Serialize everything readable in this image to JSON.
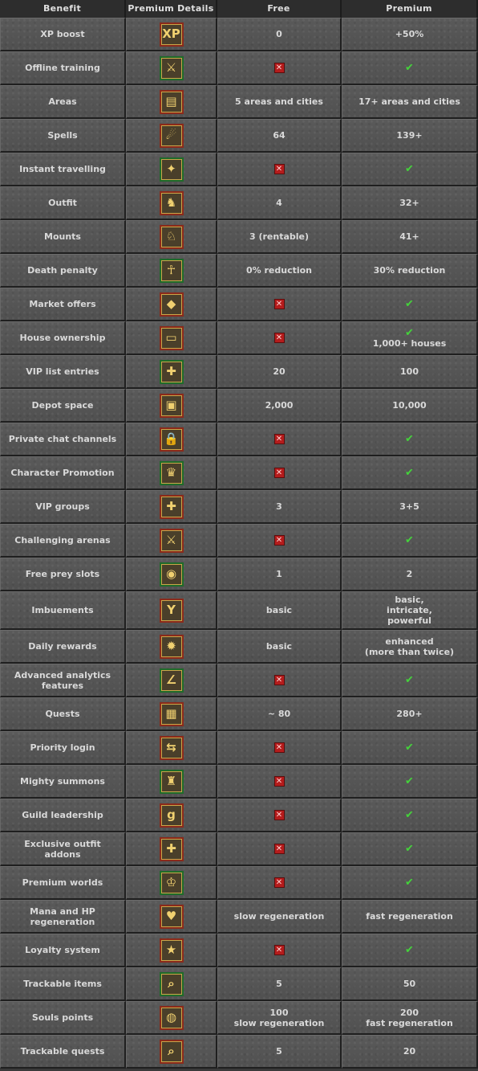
{
  "headers": {
    "benefit": "Benefit",
    "details": "Premium Details",
    "free": "Free",
    "premium": "Premium"
  },
  "colors": {
    "cross": "#b51c1c",
    "check": "#44d23b"
  },
  "rows": [
    {
      "benefit": "XP boost",
      "icon": "xp-boost-icon",
      "glyph": "XP",
      "free": "0",
      "premium": "+50%"
    },
    {
      "benefit": "Offline training",
      "icon": "offline-training-icon",
      "glyph": "⚔",
      "free": "x",
      "premium": "ok"
    },
    {
      "benefit": "Areas",
      "icon": "map-icon",
      "glyph": "▤",
      "free": "5 areas and cities",
      "premium": "17+ areas and cities"
    },
    {
      "benefit": "Spells",
      "icon": "fireball-icon",
      "glyph": "☄",
      "free": "64",
      "premium": "139+"
    },
    {
      "benefit": "Instant travelling",
      "icon": "compass-star-icon",
      "glyph": "✦",
      "free": "x",
      "premium": "ok"
    },
    {
      "benefit": "Outfit",
      "icon": "outfit-icon",
      "glyph": "♞",
      "free": "4",
      "premium": "32+"
    },
    {
      "benefit": "Mounts",
      "icon": "mount-icon",
      "glyph": "♘",
      "free": "3 (rentable)",
      "premium": "41+"
    },
    {
      "benefit": "Death penalty",
      "icon": "ankh-icon",
      "glyph": "☥",
      "free": "0% reduction",
      "premium": "30% reduction"
    },
    {
      "benefit": "Market offers",
      "icon": "market-bag-icon",
      "glyph": "◆",
      "free": "x",
      "premium": "ok"
    },
    {
      "benefit": "House ownership",
      "icon": "house-sign-icon",
      "glyph": "▭",
      "free": "x",
      "premium": "ok",
      "premium_extra": "1,000+ houses"
    },
    {
      "benefit": "VIP list entries",
      "icon": "vip-add-icon",
      "glyph": "✚",
      "free": "20",
      "premium": "100"
    },
    {
      "benefit": "Depot space",
      "icon": "depot-icon",
      "glyph": "▣",
      "free": "2,000",
      "premium": "10,000"
    },
    {
      "benefit": "Private chat channels",
      "icon": "private-chat-icon",
      "glyph": "🔒",
      "free": "x",
      "premium": "ok"
    },
    {
      "benefit": "Character Promotion",
      "icon": "promotion-icon",
      "glyph": "♛",
      "free": "x",
      "premium": "ok"
    },
    {
      "benefit": "VIP groups",
      "icon": "vip-groups-icon",
      "glyph": "✚",
      "free": "3",
      "premium": "3+5"
    },
    {
      "benefit": "Challenging arenas",
      "icon": "crossed-swords-icon",
      "glyph": "⚔",
      "free": "x",
      "premium": "ok"
    },
    {
      "benefit": "Free prey slots",
      "icon": "prey-icon",
      "glyph": "◉",
      "free": "1",
      "premium": "2"
    },
    {
      "benefit": "Imbuements",
      "icon": "imbuement-icon",
      "glyph": "Y",
      "free": "basic",
      "premium": "basic,\nintricate,\npowerful"
    },
    {
      "benefit": "Daily rewards",
      "icon": "daily-reward-icon",
      "glyph": "✹",
      "free": "basic",
      "premium": "enhanced\n(more than twice)"
    },
    {
      "benefit": "Advanced analytics\nfeatures",
      "icon": "analytics-icon",
      "glyph": "∠",
      "free": "x",
      "premium": "ok"
    },
    {
      "benefit": "Quests",
      "icon": "quest-book-icon",
      "glyph": "▦",
      "free": "~ 80",
      "premium": "280+"
    },
    {
      "benefit": "Priority login",
      "icon": "priority-login-icon",
      "glyph": "⇆",
      "free": "x",
      "premium": "ok"
    },
    {
      "benefit": "Mighty summons",
      "icon": "summon-icon",
      "glyph": "♜",
      "free": "x",
      "premium": "ok"
    },
    {
      "benefit": "Guild leadership",
      "icon": "guild-banner-icon",
      "glyph": "g",
      "free": "x",
      "premium": "ok"
    },
    {
      "benefit": "Exclusive outfit\naddons",
      "icon": "outfit-addon-icon",
      "glyph": "✚",
      "free": "x",
      "premium": "ok"
    },
    {
      "benefit": "Premium worlds",
      "icon": "premium-world-icon",
      "glyph": "♔",
      "free": "x",
      "premium": "ok"
    },
    {
      "benefit": "Mana and HP\nregeneration",
      "icon": "regeneration-icon",
      "glyph": "♥",
      "free": "slow regeneration",
      "premium": "fast regeneration"
    },
    {
      "benefit": "Loyalty system",
      "icon": "loyalty-star-icon",
      "glyph": "★",
      "free": "x",
      "premium": "ok"
    },
    {
      "benefit": "Trackable items",
      "icon": "trackable-items-icon",
      "glyph": "⌕",
      "free": "5",
      "premium": "50"
    },
    {
      "benefit": "Souls points",
      "icon": "soul-stone-icon",
      "glyph": "◍",
      "free": "100\nslow regeneration",
      "premium": "200\nfast regeneration"
    },
    {
      "benefit": "Trackable quests",
      "icon": "trackable-quests-icon",
      "glyph": "⌕",
      "free": "5",
      "premium": "20"
    }
  ]
}
